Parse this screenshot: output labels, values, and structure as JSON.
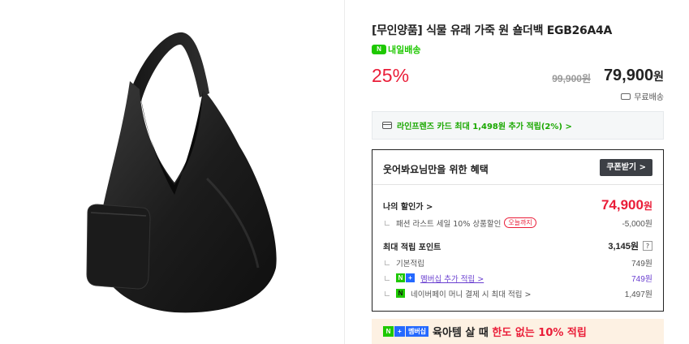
{
  "product": {
    "title": "[무인양품] 식물 유래 가죽 원 숄더백 EGB26A4A",
    "delivery_badge": "N",
    "delivery_label": "내일배송",
    "discount": "25%",
    "original_price": "99,900원",
    "sale_price": "79,900",
    "sale_currency": "원",
    "shipping": "무료배송"
  },
  "card_banner": {
    "text": "라인프렌즈 카드 최대 1,498원 추가 적립(2%) >"
  },
  "benefits": {
    "title": "웃어봐요님만을 위한 혜택",
    "coupon_button": "쿠폰받기 >",
    "my_discount_label": "나의 할인가 >",
    "my_discount_price": "74,900",
    "my_discount_currency": "원",
    "sale_event": "패션 라스트 세일 10% 상품할인",
    "sale_event_tag": "오늘까지",
    "sale_event_amount": "-5,000원",
    "max_points_label": "최대 적립 포인트",
    "max_points_value": "3,145원",
    "help": "?",
    "basic_label": "기본적립",
    "basic_value": "749원",
    "membership_n": "N",
    "membership_plus": "+",
    "membership_label": "멤버십 추가 적립 >",
    "membership_value": "749원",
    "npay_icon": "N",
    "npay_label": "네이버페이 머니 결제 시 최대 적립 >",
    "npay_value": "1,497원"
  },
  "promo": {
    "badge_n": "N",
    "badge_plus": "+",
    "badge_membership": "멤버십",
    "text_prefix": "육아템 살 때 ",
    "text_highlight": "한도 없는 10% 적립"
  },
  "colors": {
    "accent_red": "#ea1d38",
    "naver_green": "#1ec800",
    "membership_blue": "#2469ff",
    "purple_link": "#6a3fd0"
  },
  "icons": [
    "truck-icon",
    "card-icon",
    "chevron-right-icon",
    "question-icon"
  ]
}
